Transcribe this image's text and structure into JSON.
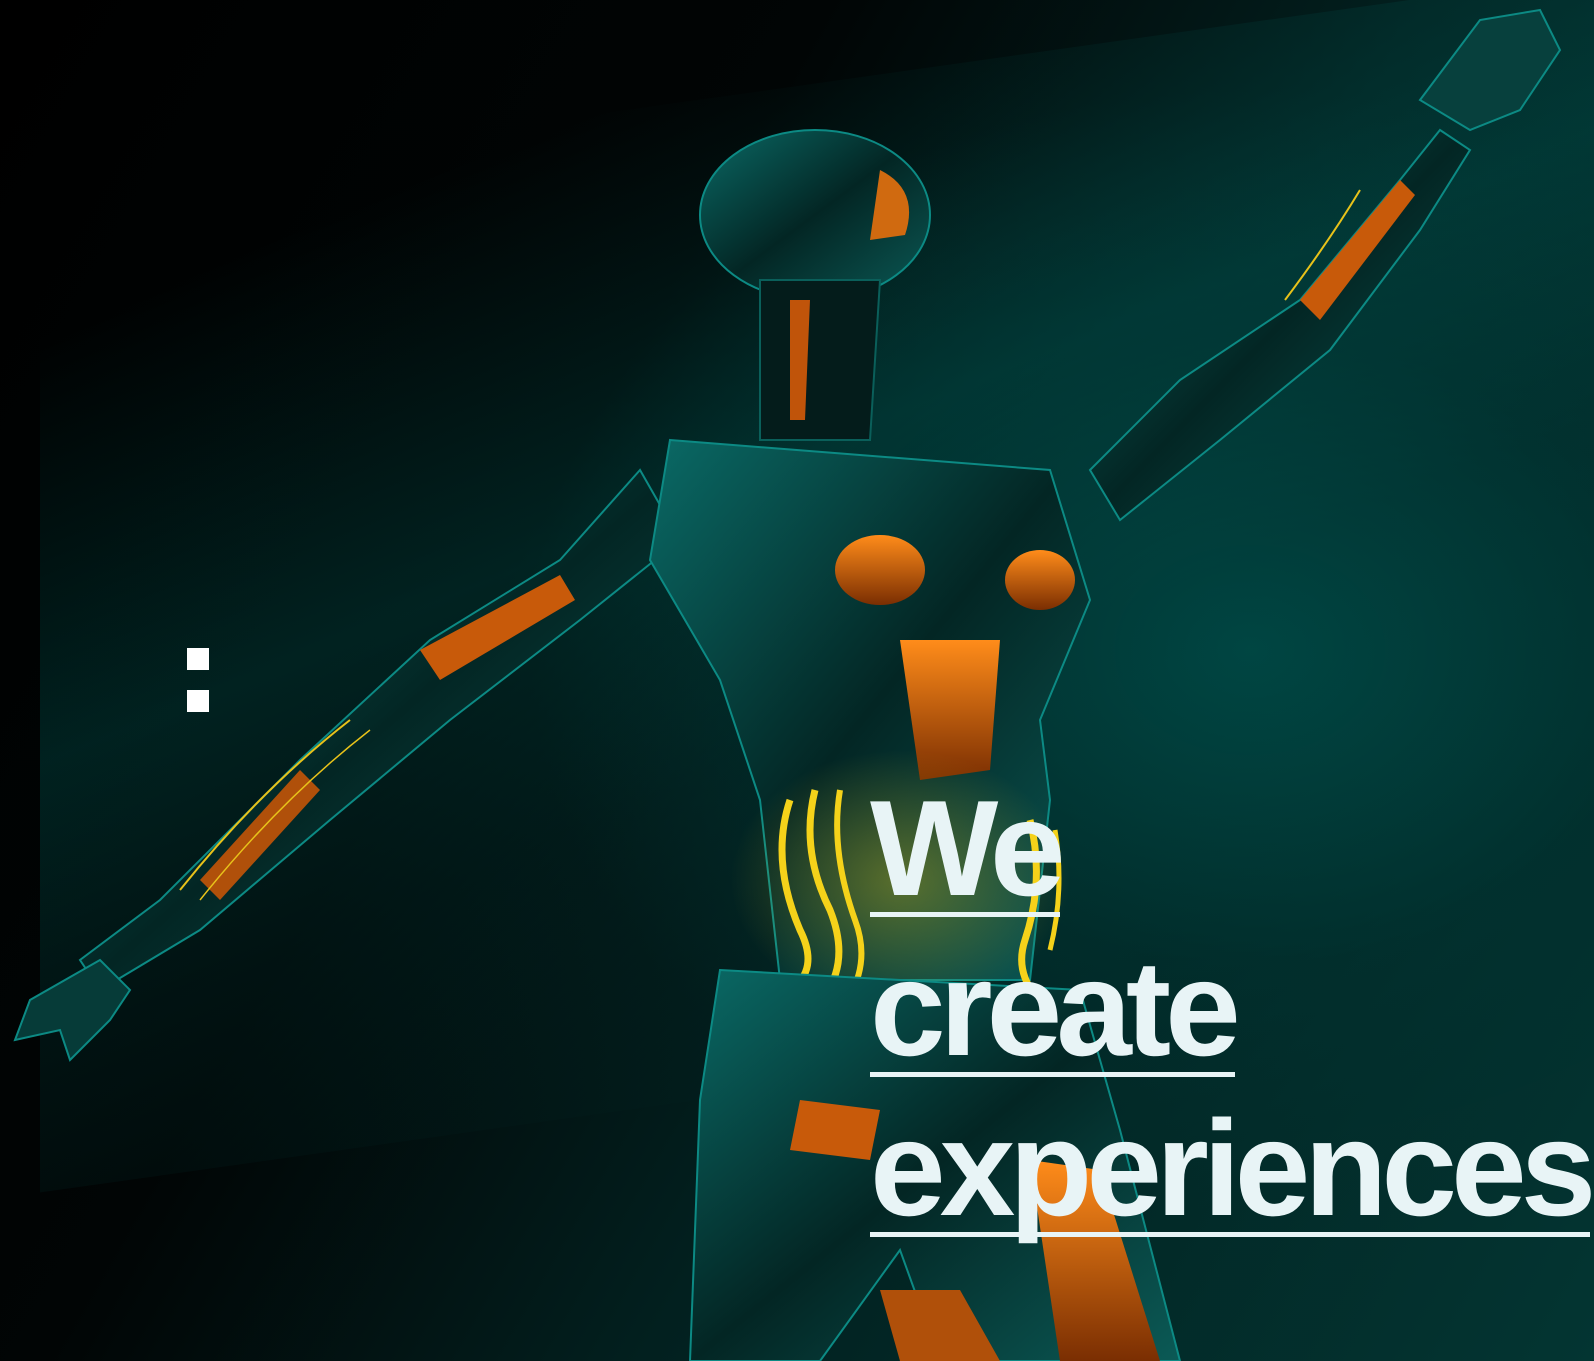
{
  "menu": {
    "icon": "two-square-dots-menu-icon"
  },
  "hero": {
    "headline_lines": [
      "We",
      "create",
      "experiences"
    ],
    "image": "teal-and-orange-robot-figure-reaching-upward"
  },
  "colors": {
    "background": "#020404",
    "teal_glow": "#004e4a",
    "accent_orange": "#ff7a10",
    "wire_yellow": "#f5d21a",
    "headline_text": "#e8f4f6"
  }
}
